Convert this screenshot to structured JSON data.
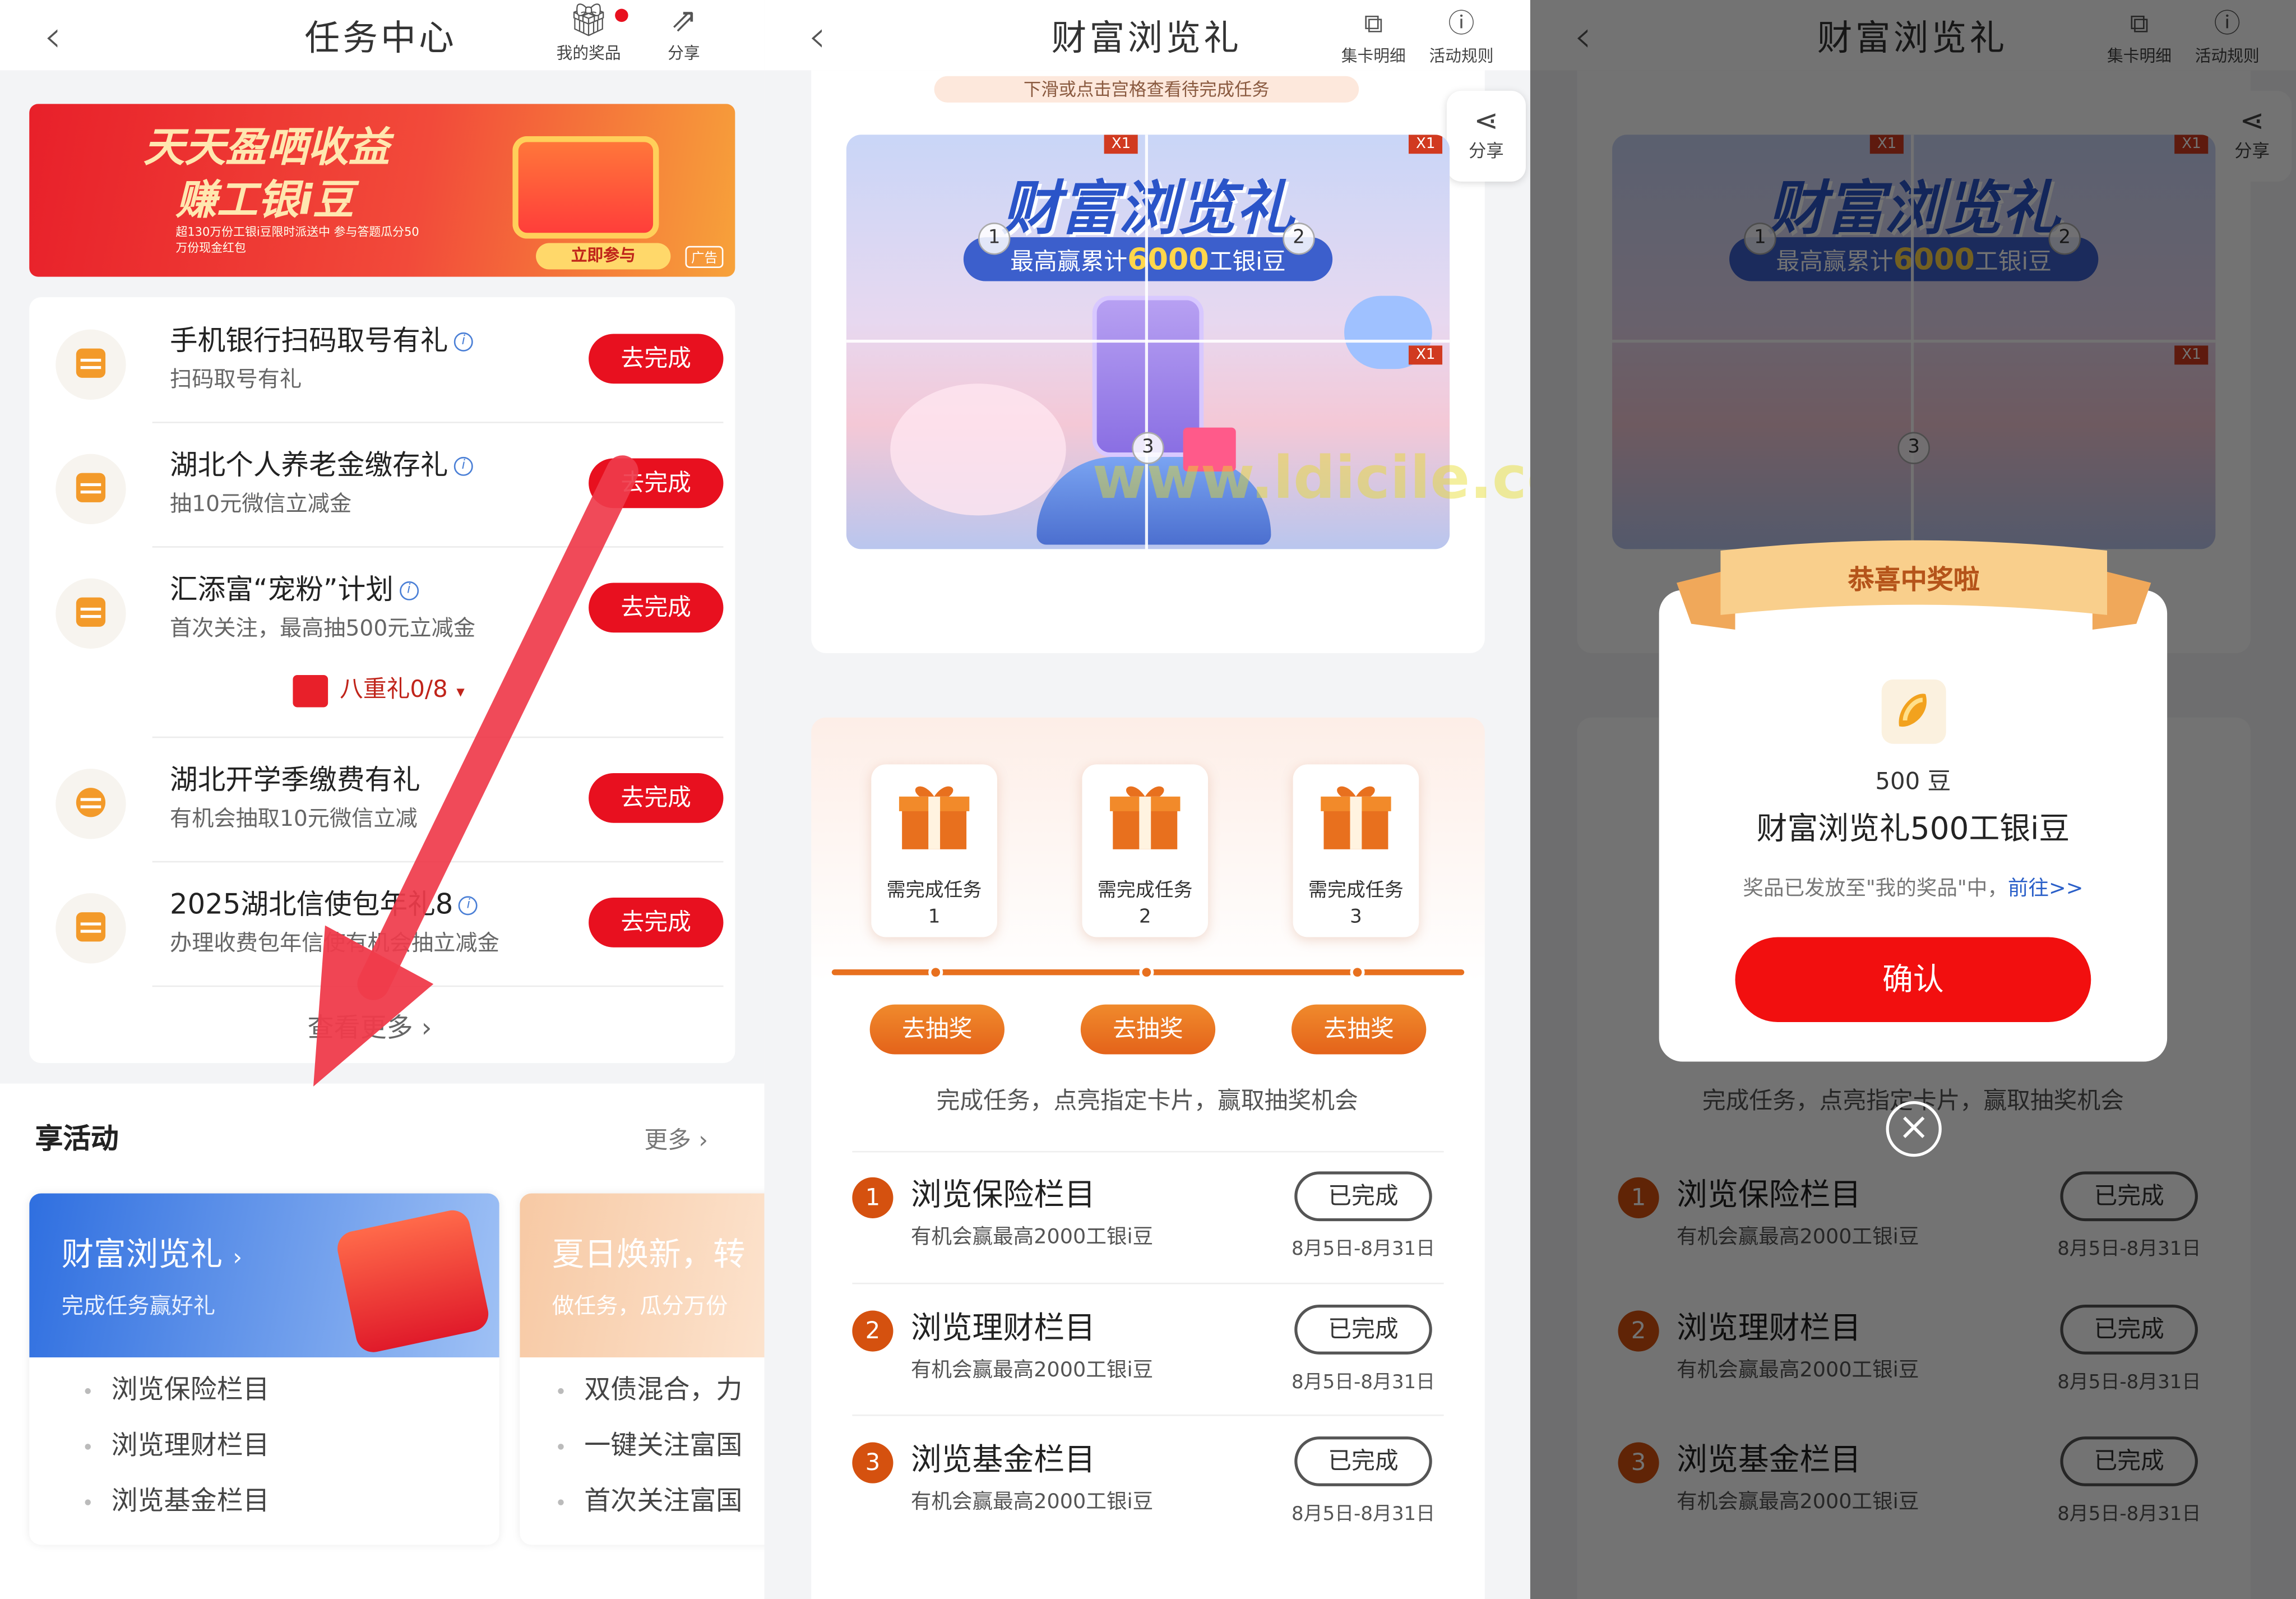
{
  "panel1": {
    "header": {
      "title": "任务中心",
      "my_prizes": "我的奖品",
      "share": "分享"
    },
    "banner": {
      "line1": "天天盈哂收益",
      "line2": "赚工银i豆",
      "small": "超130万份工银i豆限时派送中 参与答题瓜分50万份现金红包",
      "cta": "立即参与",
      "ad": "广告"
    },
    "tasks": [
      {
        "title": "手机银行扫码取号有礼",
        "sub": "扫码取号有礼",
        "btn": "去完成"
      },
      {
        "title": "湖北个人养老金缴存礼",
        "sub": "抽10元微信立减金",
        "btn": "去完成"
      },
      {
        "title": "汇添富“宠粉”计划",
        "sub": "首次关注，最高抽500元立减金",
        "btn": "去完成"
      },
      {
        "title": "湖北开学季缴费有礼",
        "sub": "有机会抽取10元微信立减",
        "btn": "去完成"
      },
      {
        "title": "2025湖北信使包年礼8",
        "sub": "办理收费包年信使有机会抽立减金",
        "btn": "去完成"
      }
    ],
    "eight_gift": "八重礼0/8",
    "see_more": "查看更多",
    "activities": {
      "title": "享活动",
      "more": "更多",
      "card1": {
        "title": "财富浏览礼",
        "sub": "完成任务赢好礼",
        "items": [
          "浏览保险栏目",
          "浏览理财栏目",
          "浏览基金栏目"
        ]
      },
      "card2": {
        "title": "夏日焕新，转",
        "sub": "做任务，瓜分万份",
        "items": [
          "双债混合，力",
          "一键关注富国",
          "首次关注富国"
        ]
      }
    }
  },
  "panel2": {
    "header": {
      "title": "财富浏览礼",
      "card_detail": "集卡明细",
      "rules": "活动规则"
    },
    "hint": "下滑或点击宫格查看待完成任务",
    "share": "分享",
    "hero": {
      "title": "财富浏览礼",
      "sub_prefix": "最高赢累计",
      "sub_amount": "6000",
      "sub_suffix": "工银i豆",
      "x1": "X1",
      "nums": [
        "1",
        "2",
        "3"
      ]
    },
    "gifts": [
      {
        "label": "需完成任务",
        "n": "1",
        "btn": "去抽奖"
      },
      {
        "label": "需完成任务",
        "n": "2",
        "btn": "去抽奖"
      },
      {
        "label": "需完成任务",
        "n": "3",
        "btn": "去抽奖"
      }
    ],
    "instruction": "完成任务，点亮指定卡片，赢取抽奖机会",
    "tasks": [
      {
        "n": "1",
        "name": "浏览保险栏目",
        "desc": "有机会赢最高2000工银i豆",
        "status": "已完成",
        "date": "8月5日-8月31日"
      },
      {
        "n": "2",
        "name": "浏览理财栏目",
        "desc": "有机会赢最高2000工银i豆",
        "status": "已完成",
        "date": "8月5日-8月31日"
      },
      {
        "n": "3",
        "name": "浏览基金栏目",
        "desc": "有机会赢最高2000工银i豆",
        "status": "已完成",
        "date": "8月5日-8月31日"
      }
    ]
  },
  "panel3": {
    "modal": {
      "ribbon": "恭喜中奖啦",
      "amount": "500 豆",
      "prize": "财富浏览礼500工银i豆",
      "note_prefix": "奖品已发放至\"我的奖品\"中，",
      "note_link": "前往>>",
      "confirm": "确认"
    }
  },
  "watermark": "www.ldicile.com",
  "colors": {
    "primary_red": "#e8101f",
    "orange": "#e4631a",
    "task_icon": "#f39a2a",
    "blue": "#3c6fd8"
  }
}
